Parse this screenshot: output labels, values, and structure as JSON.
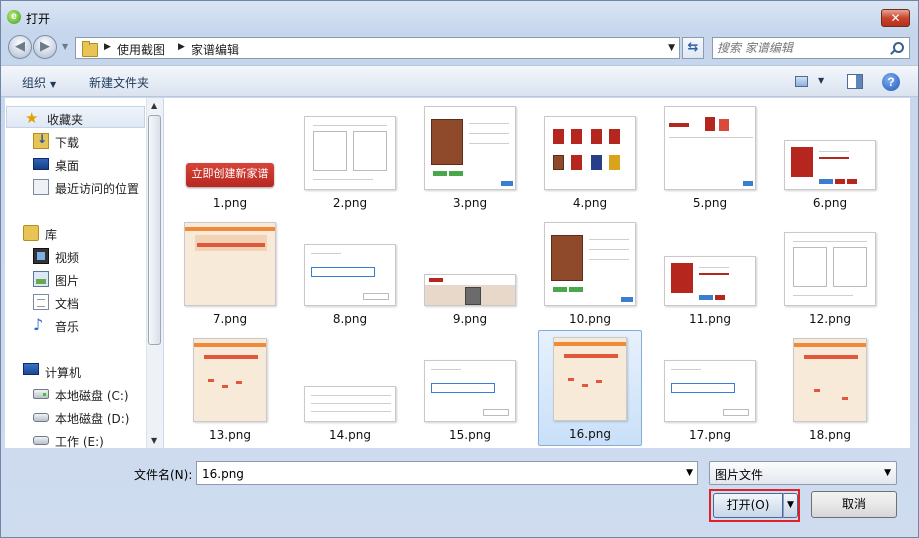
{
  "window": {
    "title": "打开"
  },
  "address": {
    "crumbs": [
      "使用截图",
      "家谱编辑"
    ],
    "search_placeholder": "搜索 家谱编辑"
  },
  "toolbar": {
    "organize": "组织",
    "new_folder": "新建文件夹"
  },
  "sidebar": {
    "items": [
      {
        "label": "收藏夹",
        "icon": "star-icon",
        "group": true
      },
      {
        "label": "下载",
        "icon": "download-folder-icon"
      },
      {
        "label": "桌面",
        "icon": "desktop-icon"
      },
      {
        "label": "最近访问的位置",
        "icon": "recent-places-icon"
      },
      {
        "label": "库",
        "icon": "library-icon",
        "group": true
      },
      {
        "label": "视频",
        "icon": "video-library-icon"
      },
      {
        "label": "图片",
        "icon": "pictures-library-icon"
      },
      {
        "label": "文档",
        "icon": "documents-library-icon"
      },
      {
        "label": "音乐",
        "icon": "music-library-icon"
      },
      {
        "label": "计算机",
        "icon": "computer-icon",
        "group": true
      },
      {
        "label": "本地磁盘 (C:)",
        "icon": "system-disk-icon"
      },
      {
        "label": "本地磁盘 (D:)",
        "icon": "local-disk-icon"
      },
      {
        "label": "工作 (E:)",
        "icon": "local-disk-icon"
      }
    ]
  },
  "files": [
    {
      "name": "1.png",
      "banner_text": "立即创建新家谱"
    },
    {
      "name": "2.png"
    },
    {
      "name": "3.png"
    },
    {
      "name": "4.png"
    },
    {
      "name": "5.png"
    },
    {
      "name": "6.png"
    },
    {
      "name": "7.png"
    },
    {
      "name": "8.png"
    },
    {
      "name": "9.png"
    },
    {
      "name": "10.png"
    },
    {
      "name": "11.png"
    },
    {
      "name": "12.png"
    },
    {
      "name": "13.png"
    },
    {
      "name": "14.png"
    },
    {
      "name": "15.png"
    },
    {
      "name": "16.png",
      "selected": true
    },
    {
      "name": "17.png"
    },
    {
      "name": "18.png"
    }
  ],
  "bottom": {
    "filename_label": "文件名(N):",
    "filename_value": "16.png",
    "filetype_value": "图片文件",
    "open_label": "打开(O)",
    "cancel_label": "取消"
  },
  "colors": {
    "selection_border": "#e0212b",
    "accent": "#b5261f"
  }
}
